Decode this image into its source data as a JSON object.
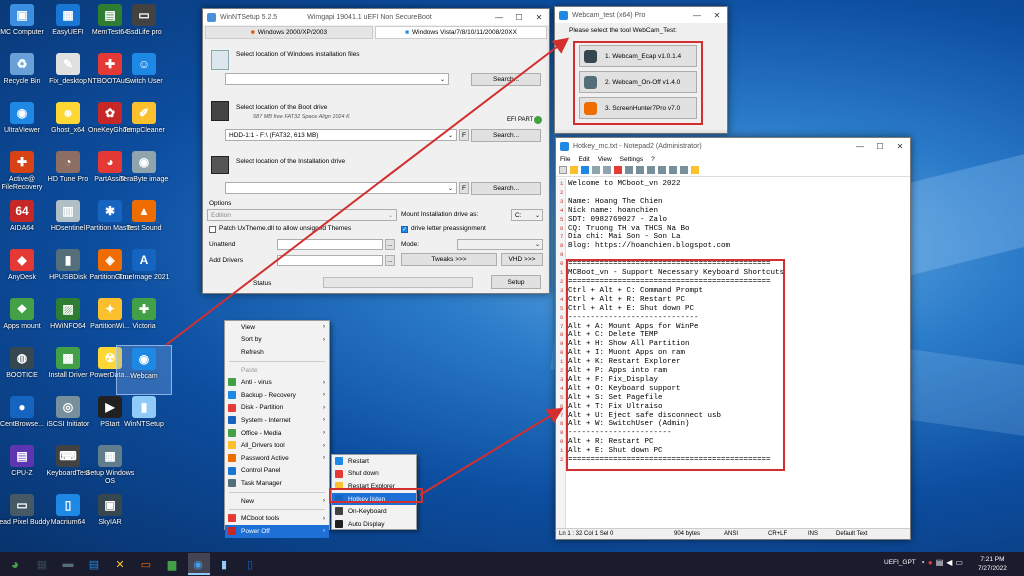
{
  "desktop_icons": [
    {
      "label": "MC Computer",
      "color": "#3b8ee0",
      "glyph": "▣"
    },
    {
      "label": "Recycle Bin",
      "color": "#6aa0d8",
      "glyph": "♻"
    },
    {
      "label": "UltraViewer",
      "color": "#1e88e5",
      "glyph": "◉"
    },
    {
      "label": "Active@ FileRecovery",
      "color": "#d84315",
      "glyph": "✚"
    },
    {
      "label": "AIDA64",
      "color": "#c62828",
      "glyph": "64"
    },
    {
      "label": "AnyDesk",
      "color": "#e53935",
      "glyph": "◆"
    },
    {
      "label": "Apps mount",
      "color": "#43a047",
      "glyph": "❖"
    },
    {
      "label": "BOOTICE",
      "color": "#37474f",
      "glyph": "◍"
    },
    {
      "label": "CentBrowse...",
      "color": "#1565c0",
      "glyph": "●"
    },
    {
      "label": "CPU-Z",
      "color": "#5e35b1",
      "glyph": "▤"
    },
    {
      "label": "Dead Pixel Buddy",
      "color": "#455a64",
      "glyph": "▭"
    },
    {
      "label": "EasyUEFI",
      "color": "#1976d2",
      "glyph": "▦"
    },
    {
      "label": "Fix_desktop",
      "color": "#e0e0e0",
      "glyph": "✎"
    },
    {
      "label": "Ghost_x64",
      "color": "#fdd835",
      "glyph": "☻"
    },
    {
      "label": "HD Tune Pro",
      "color": "#8d6e63",
      "glyph": "◔"
    },
    {
      "label": "HDsentinel",
      "color": "#b0bec5",
      "glyph": "▥"
    },
    {
      "label": "HPUSBDisk",
      "color": "#546e7a",
      "glyph": "▮"
    },
    {
      "label": "HWiNFO64",
      "color": "#2e7d32",
      "glyph": "▨"
    },
    {
      "label": "Install Driver",
      "color": "#43a047",
      "glyph": "▩"
    },
    {
      "label": "iSCSI Initiator",
      "color": "#78909c",
      "glyph": "◎"
    },
    {
      "label": "KeyboardTest",
      "color": "#424242",
      "glyph": "⌨"
    },
    {
      "label": "Macrium64",
      "color": "#1e88e5",
      "glyph": "▯"
    },
    {
      "label": "MemTest64",
      "color": "#2e7d32",
      "glyph": "▤"
    },
    {
      "label": "NTBOOTAut...",
      "color": "#e53935",
      "glyph": "✚"
    },
    {
      "label": "OneKeyGhost",
      "color": "#c62828",
      "glyph": "✿"
    },
    {
      "label": "PartAssist",
      "color": "#e53935",
      "glyph": "◕"
    },
    {
      "label": "Partition Master",
      "color": "#1565c0",
      "glyph": "✱"
    },
    {
      "label": "PartitionGuru",
      "color": "#ef6c00",
      "glyph": "◈"
    },
    {
      "label": "PartitionWi...",
      "color": "#fbc02d",
      "glyph": "✦"
    },
    {
      "label": "PowerData...",
      "color": "#fdd835",
      "glyph": "☢"
    },
    {
      "label": "PStart",
      "color": "#212121",
      "glyph": "▶"
    },
    {
      "label": "Setup Windows OS",
      "color": "#607d8b",
      "glyph": "▦"
    },
    {
      "label": "SkyIAR",
      "color": "#37474f",
      "glyph": "▣"
    },
    {
      "label": "SsdLife pro",
      "color": "#424242",
      "glyph": "▭"
    },
    {
      "label": "Switch User",
      "color": "#1e88e5",
      "glyph": "☺"
    },
    {
      "label": "TempCleaner",
      "color": "#fbc02d",
      "glyph": "✐"
    },
    {
      "label": "TeraByte image",
      "color": "#90a4ae",
      "glyph": "◉"
    },
    {
      "label": "Test Sound",
      "color": "#ef6c00",
      "glyph": "▲"
    },
    {
      "label": "TrueImage 2021",
      "color": "#1565c0",
      "glyph": "A"
    },
    {
      "label": "Victoria",
      "color": "#43a047",
      "glyph": "✚"
    },
    {
      "label": "Webcam",
      "color": "#1e88e5",
      "glyph": "◉"
    },
    {
      "label": "WinNTSetup",
      "color": "#90caf9",
      "glyph": "▮"
    }
  ],
  "winnt": {
    "title": "WinNTSetup 5.2.5",
    "title_mid": "Wimgapi 19041.1 uEFI Non SecureBoot",
    "tab1": "Windows 2000/XP/2003",
    "tab2": "Windows Vista/7/8/10/11/2008/20XX",
    "sec1_label": "Select location of Windows installation files",
    "search": "Search...",
    "sec2_label": "Select location of the Boot drive",
    "sec2_sub": "587 MB free FAT32 Space Align 1024 K",
    "efi_part": "EFI PART",
    "boot_drive": "HDD-1:1 - F:\\ (FAT32, 613 MB)",
    "f_btn": "F",
    "sec3_label": "Select location of the Installation drive",
    "options": "Options",
    "edition": "Edition",
    "mount_as": "Mount Installation drive as:",
    "mount_letter": "C:",
    "patch": "Patch UxTheme.dll to allow unsigned Themes",
    "preassign": "drive letter preassignment",
    "unattend": "Unattend",
    "mode": "Mode:",
    "add_drivers": "Add Drivers",
    "tweaks": "Tweaks >>>",
    "vhd": "VHD >>>",
    "ellipsis": "...",
    "status": "Status",
    "setup": "Setup"
  },
  "webcam": {
    "title": "Webcam_test (x64) Pro",
    "prompt": "Please select the tool WebCam_Test:",
    "items": [
      "1. Webcam_Ecap v1.0.1.4",
      "2. Webcam_On-Off v1.4.0",
      "3. ScreenHunter7Pro v7.0"
    ]
  },
  "notepad": {
    "title": "Hotkey_mc.txt - Notepad2 (Administrator)",
    "menu": [
      "File",
      "Edit",
      "View",
      "Settings",
      "?"
    ],
    "lines": [
      "Welcome to MCboot_vn 2022",
      "",
      "Name: Hoang The Chien",
      "Nick name: hoanchien",
      "SDT: 0982769027 - Zalo",
      "CQ: Truong TH va THCS Na Bo",
      "Dia chi: Mai Son - Son La",
      "Blog: https://hoanchien.blogspot.com",
      "",
      "=============================================",
      "MCBoot_vn - Support Necessary Keyboard Shortcuts",
      "=============================================",
      "Ctrl + Alt + C: Command Prompt",
      "Ctrl + Alt + R: Restart PC",
      "Ctrl + Alt + E: Shut down PC",
      "-----------------------------",
      "Alt + A: Mount Apps for WinPe",
      "Alt + C: Delete TEMP",
      "Alt + H: Show All Partition",
      "Alt + I: Muont Apps on ram",
      "Alt + K: Restart Explorer",
      "Alt + P: Apps into ram",
      "Alt + F: Fix_Display",
      "Alt + O: Keyboard support",
      "Alt + S: Set Pagefile",
      "Alt + T: Fix Ultraiso",
      "Alt + U: Eject safe disconnect usb",
      "Alt + W: SwitchUser (Admin)",
      "-----------------------",
      "Alt + R: Restart PC",
      "Alt + E: Shut down PC",
      "============================================="
    ],
    "status": [
      "Ln 1 : 32   Col 1   Sel 0",
      "904 bytes",
      "ANSI",
      "CR+LF",
      "INS",
      "Default Text"
    ]
  },
  "context_menu": {
    "items": [
      {
        "label": "View",
        "arrow": true,
        "icon": ""
      },
      {
        "label": "Sort by",
        "arrow": true,
        "icon": ""
      },
      {
        "label": "Refresh",
        "arrow": false,
        "icon": ""
      },
      {
        "sep": true
      },
      {
        "label": "Paste",
        "arrow": false,
        "icon": "",
        "disabled": true
      },
      {
        "label": "Anti - virus",
        "arrow": true,
        "icon": "#43a047"
      },
      {
        "label": "Backup - Recovery",
        "arrow": true,
        "icon": "#1e88e5"
      },
      {
        "label": "Disk - Partition",
        "arrow": true,
        "icon": "#e53935"
      },
      {
        "label": "System - Internet",
        "arrow": true,
        "icon": "#1565c0"
      },
      {
        "label": "Office - Media",
        "arrow": true,
        "icon": "#43a047"
      },
      {
        "label": "All_Drivers tool",
        "arrow": true,
        "icon": "#fbc02d"
      },
      {
        "label": "Password Active",
        "arrow": true,
        "icon": "#ef6c00"
      },
      {
        "label": "Control Panel",
        "arrow": false,
        "icon": "#1976d2"
      },
      {
        "label": "Task Manager",
        "arrow": false,
        "icon": "#546e7a"
      },
      {
        "sep": true
      },
      {
        "label": "New",
        "arrow": true,
        "icon": ""
      },
      {
        "sep": true
      },
      {
        "label": "MCboot tools",
        "arrow": true,
        "icon": "#e53935"
      },
      {
        "label": "Power Off",
        "arrow": true,
        "icon": "#c62828",
        "hl": true
      }
    ]
  },
  "submenu": {
    "items": [
      {
        "label": "Restart",
        "icon": "#1e88e5"
      },
      {
        "label": "Shut down",
        "icon": "#e53935"
      },
      {
        "label": "Restart Explorer",
        "icon": "#fbc02d"
      },
      {
        "label": "Hotkey listen",
        "icon": "#1565c0",
        "hl": true
      },
      {
        "label": "On-Keyboard",
        "icon": "#424242"
      },
      {
        "label": "Auto Display",
        "icon": "#212121"
      }
    ]
  },
  "taskbar": {
    "tray_text": "UEFI_GPT",
    "time": "7:21 PM",
    "date": "7/27/2022",
    "apps": [
      "▦",
      "▬",
      "▤",
      "✕",
      "▭",
      "▆",
      "◉",
      "▮",
      "▯"
    ]
  }
}
